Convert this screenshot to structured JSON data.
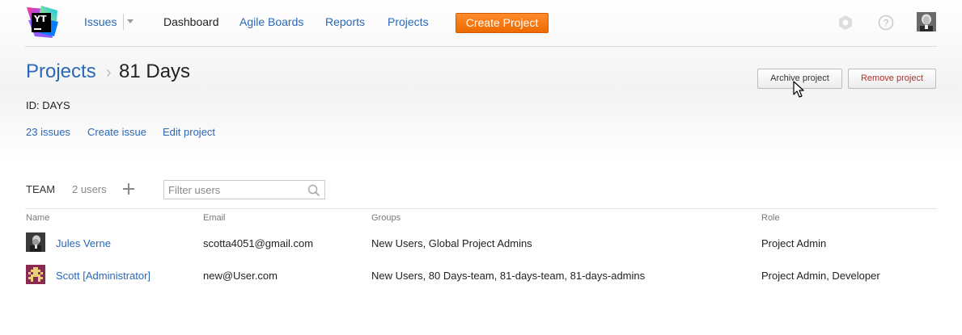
{
  "nav": {
    "logo_text": "YT",
    "issues": "Issues",
    "dashboard": "Dashboard",
    "agile_boards": "Agile Boards",
    "reports": "Reports",
    "projects": "Projects",
    "create_project": "Create Project",
    "accent": "#f57c15"
  },
  "header": {
    "breadcrumb_link": "Projects",
    "breadcrumb_sep": "›",
    "title": "81 Days",
    "archive_label": "Archive project",
    "remove_label": "Remove project",
    "id_line": "ID: DAYS"
  },
  "project_links": {
    "issues": "23 issues",
    "create_issue": "Create issue",
    "edit_project": "Edit project"
  },
  "team": {
    "label": "TEAM",
    "count": "2 users",
    "filter_placeholder": "Filter users",
    "columns": {
      "name": "Name",
      "email": "Email",
      "groups": "Groups",
      "role": "Role"
    },
    "rows": [
      {
        "name": "Jules Verne",
        "email": "scotta4051@gmail.com",
        "groups": "New Users, Global Project Admins",
        "role": "Project Admin"
      },
      {
        "name": "Scott [Administrator]",
        "email": "new@User.com",
        "groups": "New Users, 80 Days-team, 81-days-team, 81-days-admins",
        "role": "Project Admin, Developer"
      }
    ]
  }
}
